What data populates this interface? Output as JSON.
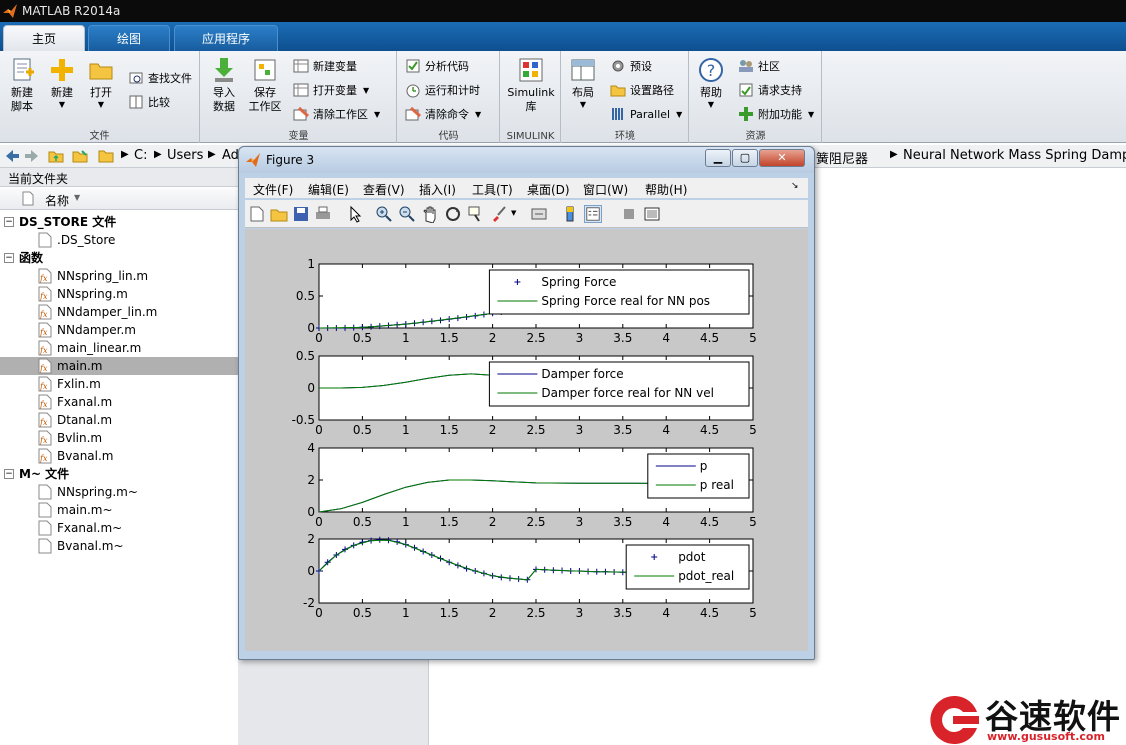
{
  "window": {
    "title": "MATLAB R2014a"
  },
  "tabs": [
    {
      "label": "主页",
      "active": true
    },
    {
      "label": "绘图",
      "active": false
    },
    {
      "label": "应用程序",
      "active": false
    }
  ],
  "ribbon": {
    "file": {
      "label": "文件",
      "new_script": "新建\n脚本",
      "new": "新建",
      "open": "打开",
      "find_files": "查找文件",
      "compare": "比较"
    },
    "variable": {
      "label": "变量",
      "import": "导入\n数据",
      "save_ws": "保存\n工作区",
      "new_var": "新建变量",
      "open_var": "打开变量",
      "clear_ws": "清除工作区"
    },
    "code": {
      "label": "代码",
      "analyze": "分析代码",
      "run_time": "运行和计时",
      "clear_cmds": "清除命令"
    },
    "simulink": {
      "label": "SIMULINK",
      "lib": "Simulink\n库"
    },
    "env": {
      "label": "环境",
      "layout": "布局",
      "prefs": "预设",
      "set_path": "设置路径",
      "parallel": "Parallel"
    },
    "resources": {
      "label": "资源",
      "help": "帮助",
      "community": "社区",
      "support": "请求支持",
      "addons": "附加功能"
    }
  },
  "address": {
    "crumbs": [
      "C:",
      "Users",
      "Ad"
    ],
    "tail_crumbs": [
      "簧阻尼器",
      "Neural Network Mass Spring Damper"
    ]
  },
  "current_folder": {
    "title": "当前文件夹",
    "column": "名称",
    "groups": [
      {
        "header": "DS_STORE 文件",
        "files": [
          ".DS_Store"
        ],
        "icon": "blank-file"
      },
      {
        "header": "函数",
        "files": [
          "NNspring_lin.m",
          "NNspring.m",
          "NNdamper_lin.m",
          "NNdamper.m",
          "main_linear.m",
          "main.m",
          "Fxlin.m",
          "Fxanal.m",
          "Dtanal.m",
          "Bvlin.m",
          "Bvanal.m"
        ],
        "icon": "function-file",
        "selected": "main.m"
      },
      {
        "header": "M~ 文件",
        "files": [
          "NNspring.m~",
          "main.m~",
          "Fxanal.m~",
          "Bvanal.m~"
        ],
        "icon": "blank-file"
      }
    ]
  },
  "figure": {
    "title": "Figure 3",
    "menus": [
      "文件(F)",
      "编辑(E)",
      "查看(V)",
      "插入(I)",
      "工具(T)",
      "桌面(D)",
      "窗口(W)",
      "帮助(H)"
    ]
  },
  "chart_data": [
    {
      "type": "line",
      "xlim": [
        0,
        5
      ],
      "ylim": [
        0,
        1
      ],
      "xticks": [
        "0",
        "0.5",
        "1",
        "1.5",
        "2",
        "2.5",
        "3",
        "3.5",
        "4",
        "4.5",
        "5"
      ],
      "yticks": [
        "0",
        "0.5",
        "1"
      ],
      "legend": {
        "placement": "top-right",
        "entries": [
          "Spring Force",
          "Spring Force real for NN pos"
        ]
      },
      "series": [
        {
          "name": "Spring Force",
          "marker": "+",
          "color": "#00008b",
          "x": [
            0,
            0.1,
            0.2,
            0.3,
            0.4,
            0.5,
            0.6,
            0.7,
            0.8,
            0.9,
            1.0,
            1.1,
            1.2,
            1.3,
            1.4,
            1.5,
            1.6,
            1.7,
            1.8,
            1.9,
            2.0,
            2.1,
            2.2,
            2.3,
            2.4,
            2.5
          ],
          "y": [
            0,
            0,
            0,
            0.002,
            0.006,
            0.012,
            0.02,
            0.03,
            0.04,
            0.05,
            0.062,
            0.075,
            0.09,
            0.105,
            0.12,
            0.138,
            0.155,
            0.172,
            0.19,
            0.21,
            0.23,
            0.25,
            0.27,
            0.29,
            0.31,
            0.33
          ]
        },
        {
          "name": "Spring Force real for NN pos",
          "marker": "",
          "color": "#007a00",
          "x": [
            0,
            0.5,
            1.0,
            1.5,
            2.0,
            2.5
          ],
          "y": [
            0,
            0.01,
            0.06,
            0.14,
            0.23,
            0.33
          ]
        }
      ]
    },
    {
      "type": "line",
      "xlim": [
        0,
        5
      ],
      "ylim": [
        -0.5,
        0.5
      ],
      "xticks": [
        "0",
        "0.5",
        "1",
        "1.5",
        "2",
        "2.5",
        "3",
        "3.5",
        "4",
        "4.5",
        "5"
      ],
      "yticks": [
        "-0.5",
        "0",
        "0.5"
      ],
      "legend": {
        "placement": "top-right",
        "entries": [
          "Damper force",
          "Damper force real for NN vel"
        ]
      },
      "series": [
        {
          "name": "Damper force",
          "marker": "",
          "color": "#00008b",
          "x": [
            0,
            0.25,
            0.5,
            0.75,
            1.0,
            1.25,
            1.5,
            1.75,
            2.0,
            2.25,
            2.5
          ],
          "y": [
            0,
            0.0,
            0.01,
            0.04,
            0.09,
            0.15,
            0.2,
            0.22,
            0.2,
            0.18,
            0.16
          ]
        },
        {
          "name": "Damper force real for NN vel",
          "marker": "",
          "color": "#007a00",
          "x": [
            0,
            0.25,
            0.5,
            0.75,
            1.0,
            1.25,
            1.5,
            1.75,
            2.0,
            2.25,
            2.5
          ],
          "y": [
            0,
            0.0,
            0.01,
            0.04,
            0.09,
            0.15,
            0.2,
            0.22,
            0.2,
            0.18,
            0.16
          ]
        }
      ]
    },
    {
      "type": "line",
      "xlim": [
        0,
        5
      ],
      "ylim": [
        0,
        4
      ],
      "xticks": [
        "0",
        "0.5",
        "1",
        "1.5",
        "2",
        "2.5",
        "3",
        "3.5",
        "4",
        "4.5",
        "5"
      ],
      "yticks": [
        "0",
        "2",
        "4"
      ],
      "legend": {
        "placement": "top-right",
        "entries": [
          "p",
          "p real"
        ]
      },
      "series": [
        {
          "name": "p",
          "marker": "",
          "color": "#00008b",
          "x": [
            0,
            0.25,
            0.5,
            0.75,
            1.0,
            1.25,
            1.5,
            1.75,
            2.0,
            2.25,
            2.5,
            3.0,
            3.5,
            4.0,
            4.2
          ],
          "y": [
            0,
            0.2,
            0.6,
            1.1,
            1.55,
            1.85,
            2.0,
            2.0,
            1.95,
            1.88,
            1.82,
            1.8,
            1.8,
            1.78,
            1.78
          ]
        },
        {
          "name": "p real",
          "marker": "",
          "color": "#007a00",
          "x": [
            0,
            0.25,
            0.5,
            0.75,
            1.0,
            1.25,
            1.5,
            1.75,
            2.0,
            2.25,
            2.5,
            3.0,
            3.5,
            4.0,
            4.2
          ],
          "y": [
            0,
            0.2,
            0.6,
            1.1,
            1.55,
            1.85,
            2.0,
            2.0,
            1.95,
            1.88,
            1.82,
            1.8,
            1.8,
            1.78,
            1.78
          ]
        }
      ]
    },
    {
      "type": "line",
      "xlim": [
        0,
        5
      ],
      "ylim": [
        -2,
        2
      ],
      "xticks": [
        "0",
        "0.5",
        "1",
        "1.5",
        "2",
        "2.5",
        "3",
        "3.5",
        "4",
        "4.5",
        "5"
      ],
      "yticks": [
        "-2",
        "0",
        "2"
      ],
      "legend": {
        "placement": "top-right",
        "entries": [
          "pdot",
          "pdot_real"
        ]
      },
      "series": [
        {
          "name": "pdot",
          "marker": "+",
          "color": "#00008b",
          "x": [
            0,
            0.1,
            0.2,
            0.3,
            0.4,
            0.5,
            0.6,
            0.7,
            0.8,
            0.9,
            1.0,
            1.1,
            1.2,
            1.3,
            1.4,
            1.5,
            1.6,
            1.7,
            1.8,
            1.9,
            2.0,
            2.1,
            2.2,
            2.3,
            2.4,
            2.5,
            2.6,
            2.7,
            2.8,
            2.9,
            3.0,
            3.1,
            3.2,
            3.3,
            3.4,
            3.5,
            3.6,
            3.7
          ],
          "y": [
            0,
            0.55,
            1.0,
            1.35,
            1.6,
            1.8,
            1.9,
            1.95,
            1.92,
            1.82,
            1.65,
            1.45,
            1.22,
            1.0,
            0.78,
            0.55,
            0.35,
            0.15,
            0.0,
            -0.15,
            -0.3,
            -0.4,
            -0.45,
            -0.5,
            -0.55,
            0.1,
            0.08,
            0.05,
            0.03,
            0.0,
            0.0,
            -0.03,
            -0.05,
            -0.05,
            -0.06,
            -0.08,
            -0.08,
            -0.08
          ]
        },
        {
          "name": "pdot_real",
          "marker": "",
          "color": "#007a00",
          "x": [
            0,
            0.2,
            0.4,
            0.6,
            0.8,
            1.0,
            1.2,
            1.4,
            1.6,
            1.8,
            2.0,
            2.2,
            2.4,
            2.5,
            2.8,
            3.2,
            3.7
          ],
          "y": [
            0,
            1.0,
            1.6,
            1.9,
            1.92,
            1.65,
            1.22,
            0.78,
            0.35,
            0.0,
            -0.3,
            -0.45,
            -0.55,
            0.1,
            0.03,
            -0.05,
            -0.08
          ]
        }
      ]
    }
  ],
  "watermark": {
    "brand": "谷速软件",
    "url": "www.gususoft.com",
    "color": "#d9232a"
  }
}
